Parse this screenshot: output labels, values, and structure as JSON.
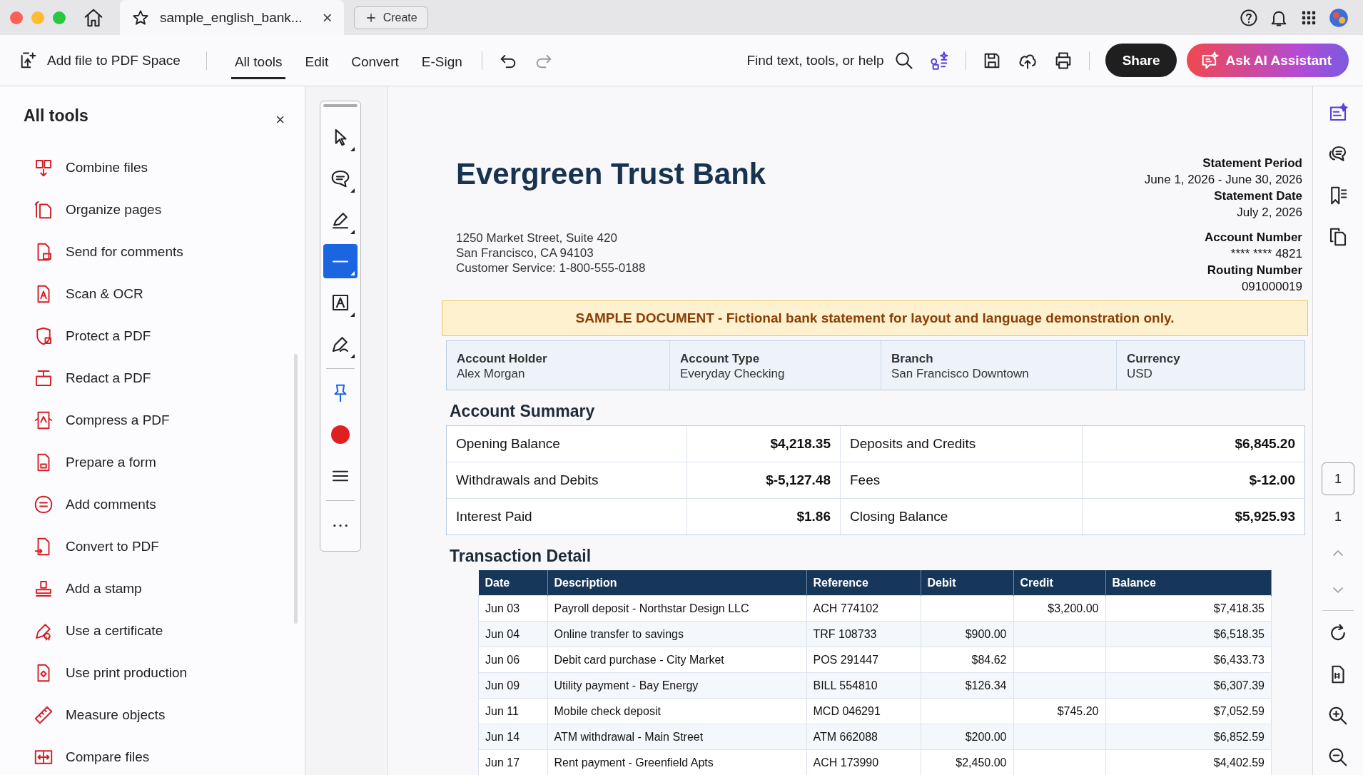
{
  "tab": {
    "title": "sample_english_bank...",
    "close": "×"
  },
  "create_button": "Create",
  "toolbar": {
    "add_file": "Add file to PDF Space",
    "nav": [
      {
        "label": "All tools",
        "selected": true
      },
      {
        "label": "Edit",
        "selected": false
      },
      {
        "label": "Convert",
        "selected": false
      },
      {
        "label": "E-Sign",
        "selected": false
      }
    ],
    "history": [
      {
        "kind": "undo",
        "disabled": false
      },
      {
        "kind": "redo",
        "disabled": true
      }
    ],
    "search": "Find text, tools, or help",
    "share": "Share",
    "ask_ai": "Ask AI Assistant"
  },
  "tools_panel": {
    "title": "All tools",
    "close": "×",
    "items": [
      "Combine files",
      "Organize pages",
      "Send for comments",
      "Scan & OCR",
      "Protect a PDF",
      "Redact a PDF",
      "Compress a PDF",
      "Prepare a form",
      "Add comments",
      "Convert to PDF",
      "Add a stamp",
      "Use a certificate",
      "Use print production",
      "Measure objects",
      "Compare files"
    ]
  },
  "quick_tools": [
    {
      "kind": "select",
      "selected": false
    },
    {
      "kind": "comment",
      "selected": false
    },
    {
      "kind": "highlight",
      "selected": false
    },
    {
      "kind": "line",
      "selected": true
    },
    {
      "kind": "textbox",
      "selected": false
    },
    {
      "kind": "sign",
      "selected": false
    },
    {
      "kind": "separator"
    },
    {
      "kind": "pin",
      "selected": false
    },
    {
      "kind": "color",
      "color": "#e02020"
    },
    {
      "kind": "stroke",
      "selected": false
    },
    {
      "kind": "separator"
    },
    {
      "kind": "more",
      "selected": false
    }
  ],
  "document": {
    "bank_name": "Evergreen Trust Bank",
    "address": [
      "1250 Market Street, Suite 420",
      "San Francisco, CA 94103",
      "Customer Service: 1-800-555-0188"
    ],
    "meta": [
      {
        "label": "Statement Period",
        "value": "June 1, 2026 - June 30, 2026"
      },
      {
        "label": "Statement Date",
        "value": "July 2, 2026"
      },
      {
        "label": "Account Number",
        "value": "**** **** 4821"
      },
      {
        "label": "Routing Number",
        "value": "091000019"
      }
    ],
    "notice": "SAMPLE DOCUMENT - Fictional bank statement for layout and language demonstration only.",
    "account_info": [
      {
        "label": "Account Holder",
        "value": "Alex Morgan"
      },
      {
        "label": "Account Type",
        "value": "Everyday Checking"
      },
      {
        "label": "Branch",
        "value": "San Francisco Downtown"
      },
      {
        "label": "Currency",
        "value": "USD"
      }
    ],
    "summary": {
      "title": "Account Summary",
      "rows": [
        [
          {
            "label": "Opening Balance",
            "amount": "$4,218.35"
          },
          {
            "label": "Deposits and Credits",
            "amount": "$6,845.20"
          }
        ],
        [
          {
            "label": "Withdrawals and Debits",
            "amount": "$-5,127.48"
          },
          {
            "label": "Fees",
            "amount": "$-12.00"
          }
        ],
        [
          {
            "label": "Interest Paid",
            "amount": "$1.86"
          },
          {
            "label": "Closing Balance",
            "amount": "$5,925.93"
          }
        ]
      ]
    },
    "transactions": {
      "title": "Transaction Detail",
      "columns": [
        "Date",
        "Description",
        "Reference",
        "Debit",
        "Credit",
        "Balance"
      ],
      "rows": [
        {
          "date": "Jun 03",
          "description": "Payroll deposit - Northstar Design LLC",
          "reference": "ACH 774102",
          "credit": "$3,200.00",
          "balance": "$7,418.35"
        },
        {
          "date": "Jun 04",
          "description": "Online transfer to savings",
          "reference": "TRF 108733",
          "debit": "$900.00",
          "balance": "$6,518.35"
        },
        {
          "date": "Jun 06",
          "description": "Debit card purchase - City Market",
          "reference": "POS 291447",
          "debit": "$84.62",
          "balance": "$6,433.73"
        },
        {
          "date": "Jun 09",
          "description": "Utility payment - Bay Energy",
          "reference": "BILL 554810",
          "debit": "$126.34",
          "balance": "$6,307.39"
        },
        {
          "date": "Jun 11",
          "description": "Mobile check deposit",
          "reference": "MCD 046291",
          "credit": "$745.20",
          "balance": "$7,052.59"
        },
        {
          "date": "Jun 14",
          "description": "ATM withdrawal - Main Street",
          "reference": "ATM 662088",
          "debit": "$200.00",
          "balance": "$6,852.59"
        },
        {
          "date": "Jun 17",
          "description": "Rent payment - Greenfield Apts",
          "reference": "ACH 173990",
          "debit": "$2,450.00",
          "balance": "$4,402.59"
        }
      ]
    }
  },
  "page_nav": {
    "current": "1",
    "total": "1"
  }
}
